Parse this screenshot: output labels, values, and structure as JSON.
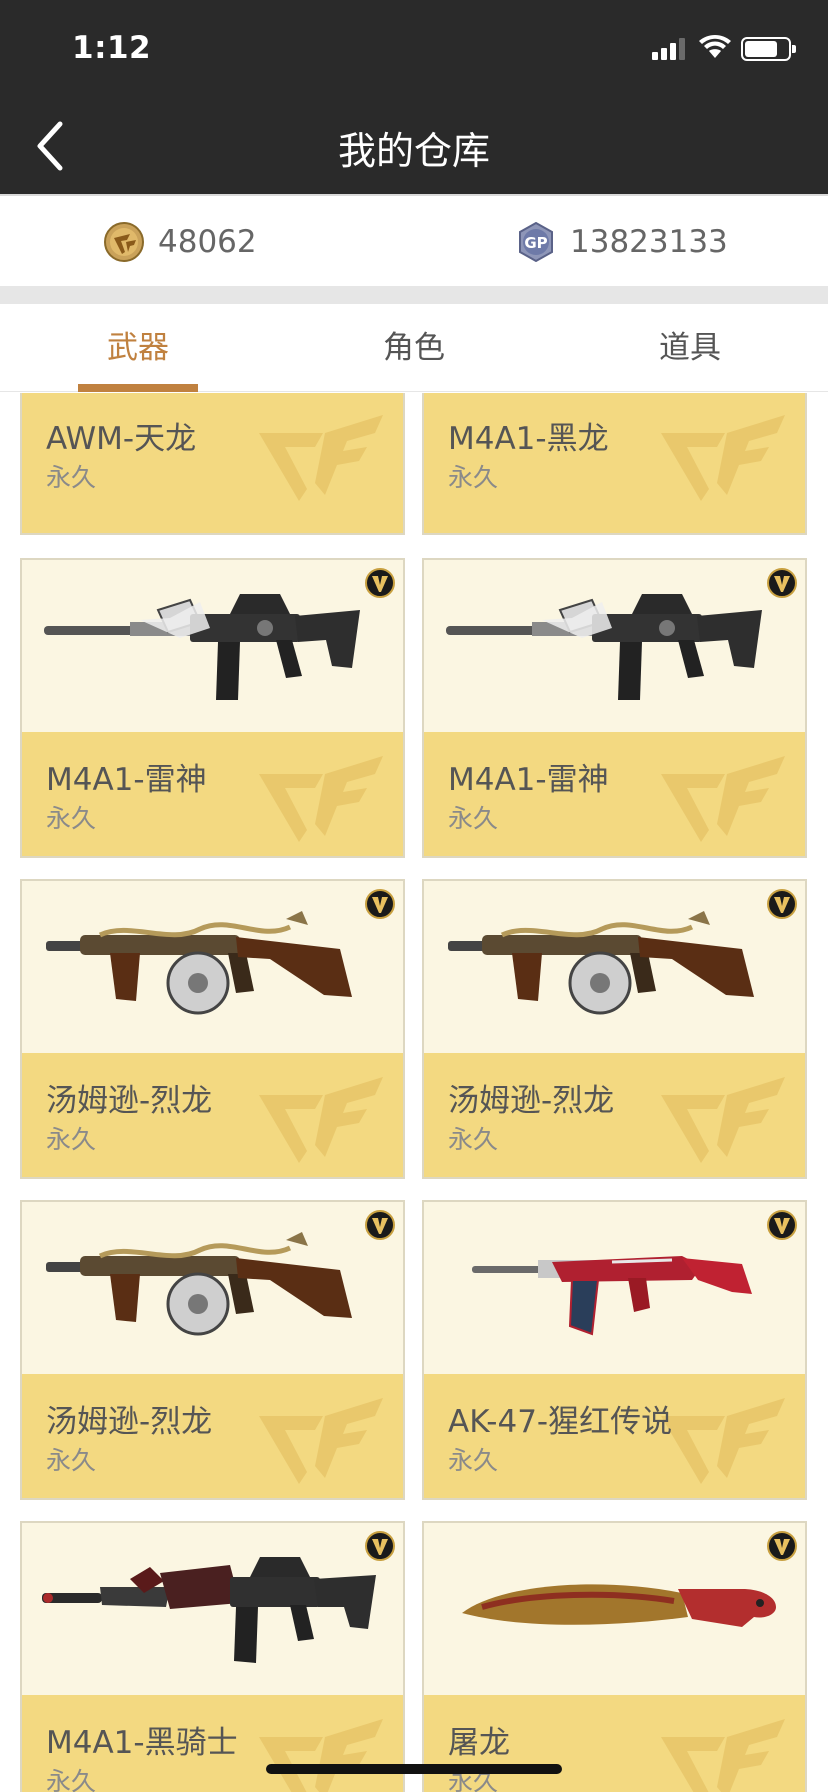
{
  "status_bar": {
    "time": "1:12"
  },
  "header": {
    "title": "我的仓库"
  },
  "currencies": [
    {
      "icon": "cf-coin-icon",
      "value": "48062"
    },
    {
      "icon": "gp-coin-icon",
      "value": "13823133"
    }
  ],
  "tabs": [
    {
      "label": "武器",
      "active": true
    },
    {
      "label": "角色",
      "active": false
    },
    {
      "label": "道具",
      "active": false
    }
  ],
  "items": [
    {
      "name": "AWM-天龙",
      "duration": "永久"
    },
    {
      "name": "M4A1-黑龙",
      "duration": "永久"
    },
    {
      "name": "M4A1-雷神",
      "duration": "永久",
      "image": "rifle-thunder"
    },
    {
      "name": "M4A1-雷神",
      "duration": "永久",
      "image": "rifle-thunder"
    },
    {
      "name": "汤姆逊-烈龙",
      "duration": "永久",
      "image": "thompson-dragon"
    },
    {
      "name": "汤姆逊-烈龙",
      "duration": "永久",
      "image": "thompson-dragon"
    },
    {
      "name": "汤姆逊-烈龙",
      "duration": "永久",
      "image": "thompson-dragon"
    },
    {
      "name": "AK-47-猩红传说",
      "duration": "永久",
      "image": "ak47-crimson"
    },
    {
      "name": "M4A1-黑骑士",
      "duration": "永久",
      "image": "rifle-black-knight"
    },
    {
      "name": "屠龙",
      "duration": "永久",
      "image": "dragon-knife"
    }
  ],
  "colors": {
    "header_bg": "#2a2a2a",
    "accent": "#c0813f",
    "card_info_bg": "#f3d981",
    "card_image_bg": "#fbf6e2"
  }
}
